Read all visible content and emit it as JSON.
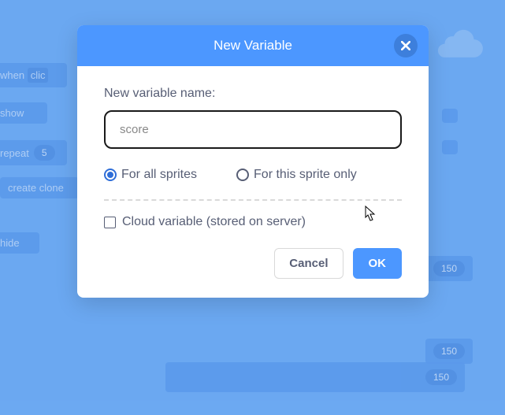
{
  "bg": {
    "b1": "when",
    "b1b": "clic",
    "b2": "show",
    "b3": "repeat",
    "b3pill": "5",
    "b4": "create clone",
    "b5": "hide",
    "p150a": "150",
    "p150b": "150",
    "p150c": "150"
  },
  "dialog": {
    "title": "New Variable",
    "label": "New variable name:",
    "input_value": "score",
    "radio_all": "For all sprites",
    "radio_this": "For this sprite only",
    "cloud_label": "Cloud variable (stored on server)",
    "cancel": "Cancel",
    "ok": "OK"
  }
}
